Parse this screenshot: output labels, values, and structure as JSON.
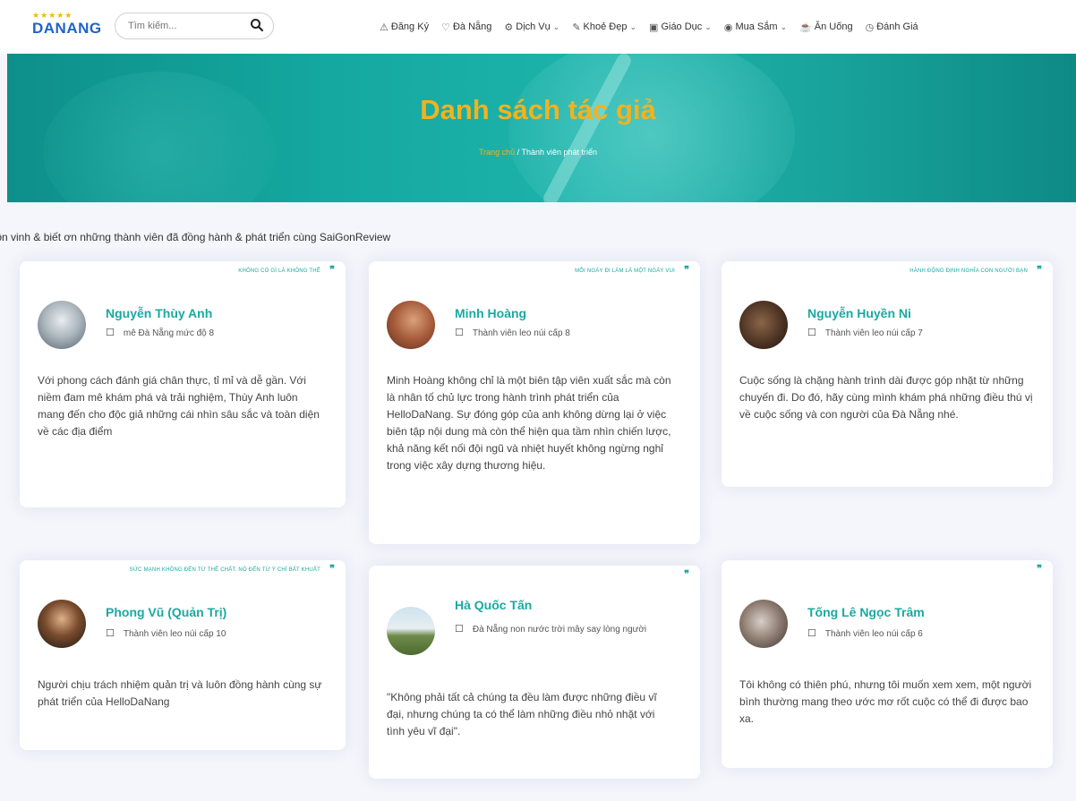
{
  "header": {
    "logo_stars": "★★★★★",
    "logo_text": "DANANG",
    "search_placeholder": "Tìm kiếm...",
    "nav": [
      {
        "label": "Đăng Ký",
        "icon": "user-plus-icon",
        "has_dropdown": false
      },
      {
        "label": "Đà Nẵng",
        "icon": "heart-icon",
        "has_dropdown": false
      },
      {
        "label": "Dịch Vụ",
        "icon": "service-icon",
        "has_dropdown": true
      },
      {
        "label": "Khoẻ Đẹp",
        "icon": "beauty-icon",
        "has_dropdown": true
      },
      {
        "label": "Giáo Dục",
        "icon": "education-icon",
        "has_dropdown": true
      },
      {
        "label": "Mua Sắm",
        "icon": "shopping-icon",
        "has_dropdown": true
      },
      {
        "label": "Ăn Uống",
        "icon": "food-icon",
        "has_dropdown": false
      },
      {
        "label": "Đánh Giá",
        "icon": "review-icon",
        "has_dropdown": false
      }
    ]
  },
  "banner": {
    "title": "Danh sách tác giả",
    "breadcrumb_home": "Trang chủ",
    "breadcrumb_sep": " / ",
    "breadcrumb_current": "Thành viên phát triển"
  },
  "intro": "Tôn vinh & biết ơn những thành viên đã đồng hành & phát triển cùng SaiGonReview",
  "colors": {
    "accent": "#1aa9a1",
    "title_gold": "#f3b21f",
    "brand_blue": "#1f63c7"
  },
  "authors": [
    {
      "quote": "Không có gì là không thể",
      "name": "Nguyễn Thùy Anh",
      "level": "mê Đà Nẵng mức độ 8",
      "bio": "Với phong cách đánh giá chân thực, tỉ mỉ và dễ gần. Với niềm đam mê khám phá và trải nghiệm, Thùy Anh luôn mang đến cho độc giả những cái nhìn sâu sắc và toàn diện về các địa điểm"
    },
    {
      "quote": "Mỗi ngày đi làm là một ngày vui",
      "name": "Minh Hoàng",
      "level": "Thành viên leo núi cấp 8",
      "bio": "Minh Hoàng không chỉ là một biên tập viên xuất sắc mà còn là nhân tố chủ lực trong hành trình phát triển của HelloDaNang. Sự đóng góp của anh không dừng lại ở việc biên tập nội dung mà còn thể hiện qua tầm nhìn chiến lược, khả năng kết nối đội ngũ và nhiệt huyết không ngừng nghỉ trong việc xây dựng thương hiệu."
    },
    {
      "quote": "Hành động định nghĩa con người bạn",
      "name": "Nguyễn Huyền Ni",
      "level": "Thành viên leo núi cấp 7",
      "bio": "Cuộc sống là chặng hành trình dài được góp nhặt từ những chuyến đi. Do đó, hãy cùng mình khám phá những điều thú vị về cuộc sống và con người của Đà Nẵng nhé."
    },
    {
      "quote": "Sức mạnh không đến từ thể chất. Nó đến từ ý chí bất khuất",
      "name": "Phong Vũ (Quản Trị)",
      "level": "Thành viên leo núi cấp 10",
      "bio": "Người chịu trách nhiệm quản trị và luôn đồng hành cùng sự phát triển của HelloDaNang"
    },
    {
      "quote": "",
      "name": "Hà Quốc Tấn",
      "level": "Đà Nẵng non nước trời mây say lòng người",
      "bio": "\"Không phải tất cả chúng ta đều làm được những điều vĩ đại, nhưng chúng ta có thể làm những điều nhỏ nhặt với tình yêu vĩ đại\"."
    },
    {
      "quote": "",
      "name": "Tống Lê Ngọc Trâm",
      "level": "Thành viên leo núi cấp 6",
      "bio": "Tôi không có thiên phú, nhưng tôi muốn xem xem, một người bình thường mang theo ước mơ rốt cuộc có thể đi được bao xa."
    }
  ]
}
